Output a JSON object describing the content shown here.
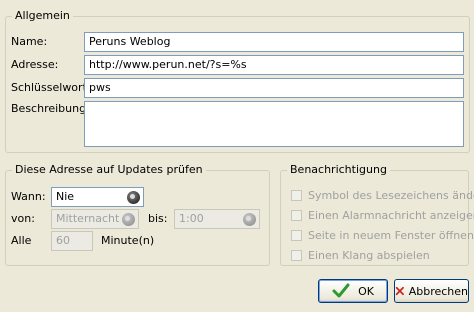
{
  "general": {
    "title": "Allgemein",
    "name_label": "Name:",
    "name_value": "Peruns Weblog",
    "address_label": "Adresse:",
    "address_value": "http://www.perun.net/?s=%s",
    "keyword_label": "Schlüsselwort:",
    "keyword_value": "pws",
    "description_label": "Beschreibung:",
    "description_value": ""
  },
  "updates": {
    "title": "Diese Adresse auf Updates prüfen",
    "when_label": "Wann:",
    "when_value": "Nie",
    "from_label": "von:",
    "from_value": "Mitternacht",
    "to_label": "bis:",
    "to_value": "1:00",
    "every_label": "Alle",
    "every_value": "60",
    "unit_label": "Minute(n)"
  },
  "notification": {
    "title": "Benachrichtigung",
    "options": [
      "Symbol des Lesezeichens ändern",
      "Einen Alarmnachricht anzeigen",
      "Seite in neuem Fenster öffnen",
      "Einen Klang abspielen"
    ]
  },
  "buttons": {
    "ok_label": "OK",
    "cancel_label": "Abbrechen"
  },
  "colors": {
    "background": "#ece9d8",
    "ok_check": "#2e9a2e",
    "cancel_x": "#d0251a"
  },
  "icons": {
    "ok": "checkmark-icon",
    "cancel": "x-icon"
  }
}
